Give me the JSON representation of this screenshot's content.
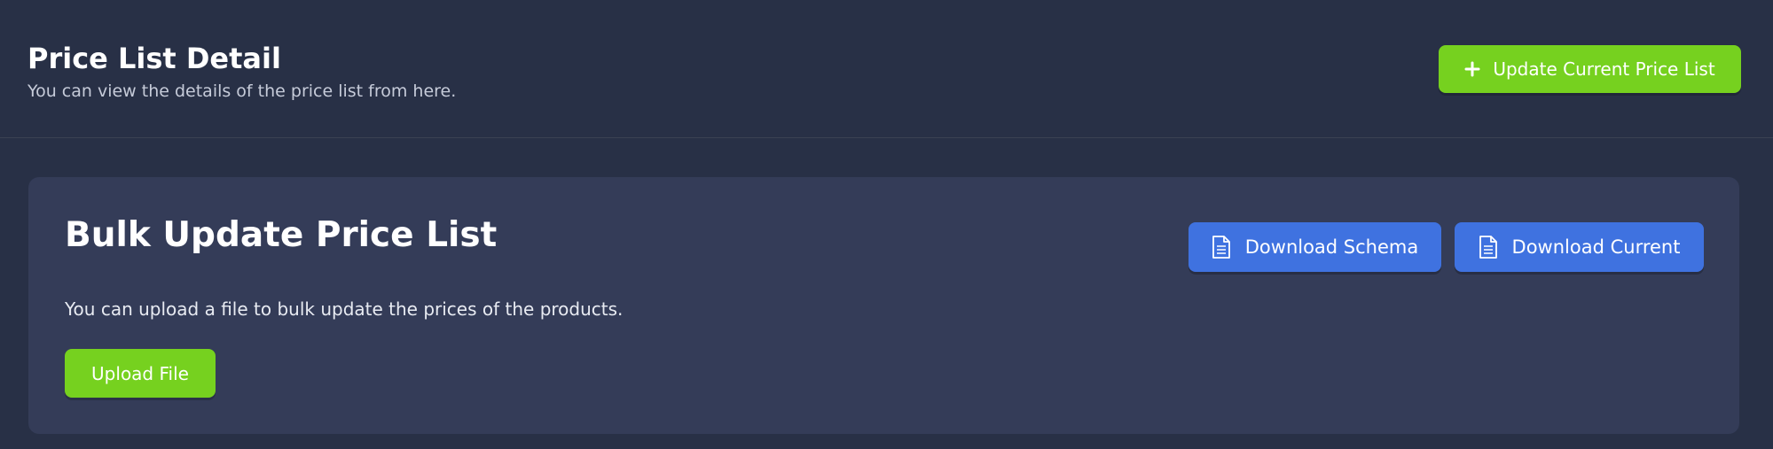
{
  "header": {
    "title": "Price List Detail",
    "subtitle": "You can view the details of the price list from here.",
    "update_button_label": "Update Current Price List",
    "update_button_icon": "plus-icon"
  },
  "bulk_update": {
    "title": "Bulk Update Price List",
    "description": "You can upload a file to bulk update the prices of the products.",
    "download_schema_label": "Download Schema",
    "download_current_label": "Download Current",
    "download_icon": "document-icon",
    "upload_label": "Upload File"
  },
  "colors": {
    "background": "#283046",
    "card": "#343c58",
    "primary_green": "#76d11f",
    "primary_blue": "#3f72e0"
  }
}
